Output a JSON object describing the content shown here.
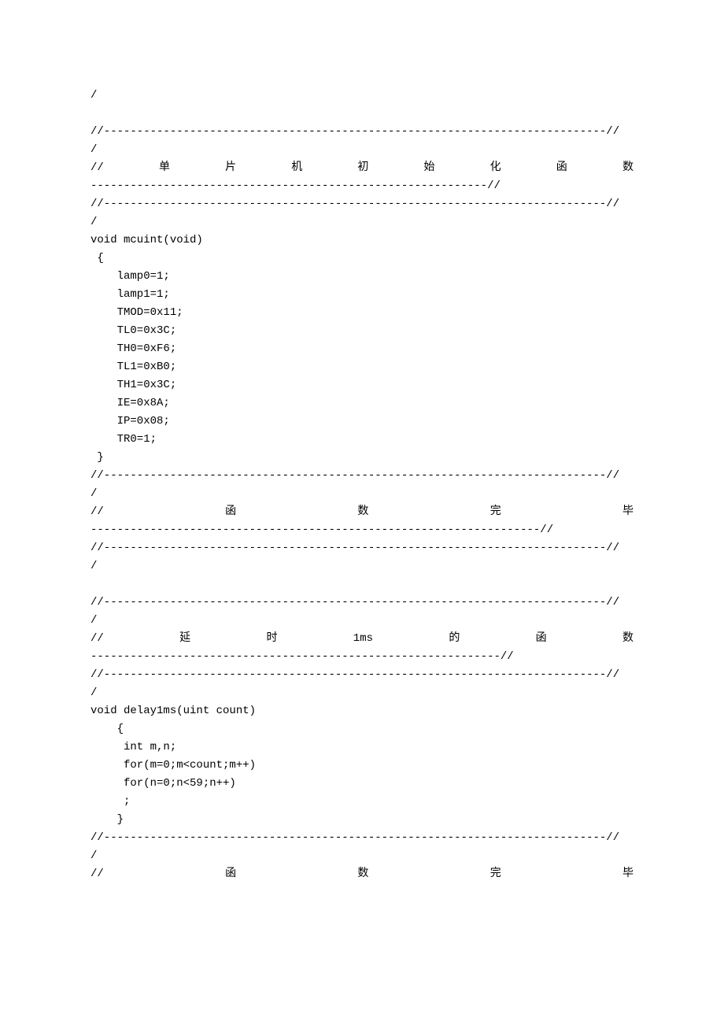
{
  "top_slash": "/",
  "divider_long": "//----------------------------------------------------------------------------//",
  "divider_long_slash": "/",
  "section1_header_chars": [
    "//",
    "单",
    "片",
    "机",
    "初",
    "始",
    "化",
    "函",
    "数"
  ],
  "section1_header_dashes": "------------------------------------------------------------//",
  "mcu_lines": [
    "void mcuint(void)",
    " {",
    "    lamp0=1;",
    "    lamp1=1;",
    "    TMOD=0x11;",
    "    TL0=0x3C;",
    "    TH0=0xF6;",
    "    TL1=0xB0;",
    "    TH1=0x3C;",
    "    IE=0x8A;",
    "    IP=0x08;",
    "    TR0=1;",
    " }"
  ],
  "section1_footer_chars": [
    "//",
    "函",
    "数",
    "完",
    "毕"
  ],
  "section1_footer_dashes": "--------------------------------------------------------------------//",
  "section2_header_chars": [
    "//",
    "延",
    "时",
    "1ms",
    "的",
    "函",
    "数"
  ],
  "section2_header_dashes": "--------------------------------------------------------------//",
  "delay_lines": [
    "void delay1ms(uint count)",
    "    {",
    "     int m,n;",
    "     for(m=0;m<count;m++)",
    "     for(n=0;n<59;n++)",
    "     ;",
    "    }"
  ],
  "section2_footer_chars": [
    "//",
    "函",
    "数",
    "完",
    "毕"
  ]
}
